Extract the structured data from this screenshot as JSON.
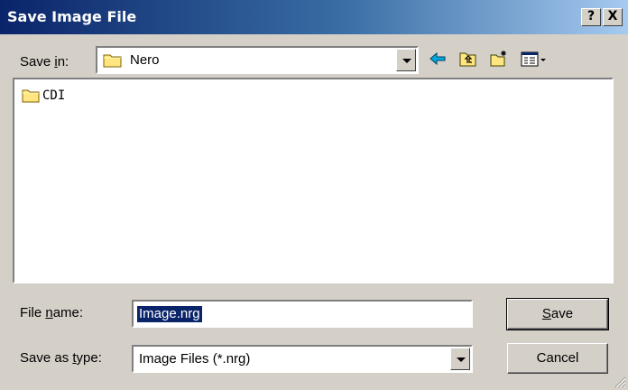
{
  "window": {
    "title": "Save Image File",
    "help_label": "?",
    "close_label": "X"
  },
  "toolbar": {
    "save_in_label_pre": "Save ",
    "save_in_label_mnemonic": "i",
    "save_in_label_post": "n:",
    "save_in_value": "Nero"
  },
  "file_list": {
    "items": [
      {
        "name": "CDI",
        "icon": "folder-icon"
      }
    ]
  },
  "form": {
    "file_name_label_pre": "File ",
    "file_name_label_mnemonic": "n",
    "file_name_label_post": "ame:",
    "file_name_value": "Image.nrg",
    "save_type_label_pre": "Save as ",
    "save_type_label_mnemonic": "t",
    "save_type_label_post": "ype:",
    "save_type_value": "Image Files (*.nrg)"
  },
  "buttons": {
    "save_mnemonic": "S",
    "save_rest": "ave",
    "cancel_label": "Cancel"
  },
  "colors": {
    "title_start": "#0a246a",
    "title_end": "#a6caf0",
    "face": "#d4d0c8",
    "selection": "#0a246a"
  }
}
